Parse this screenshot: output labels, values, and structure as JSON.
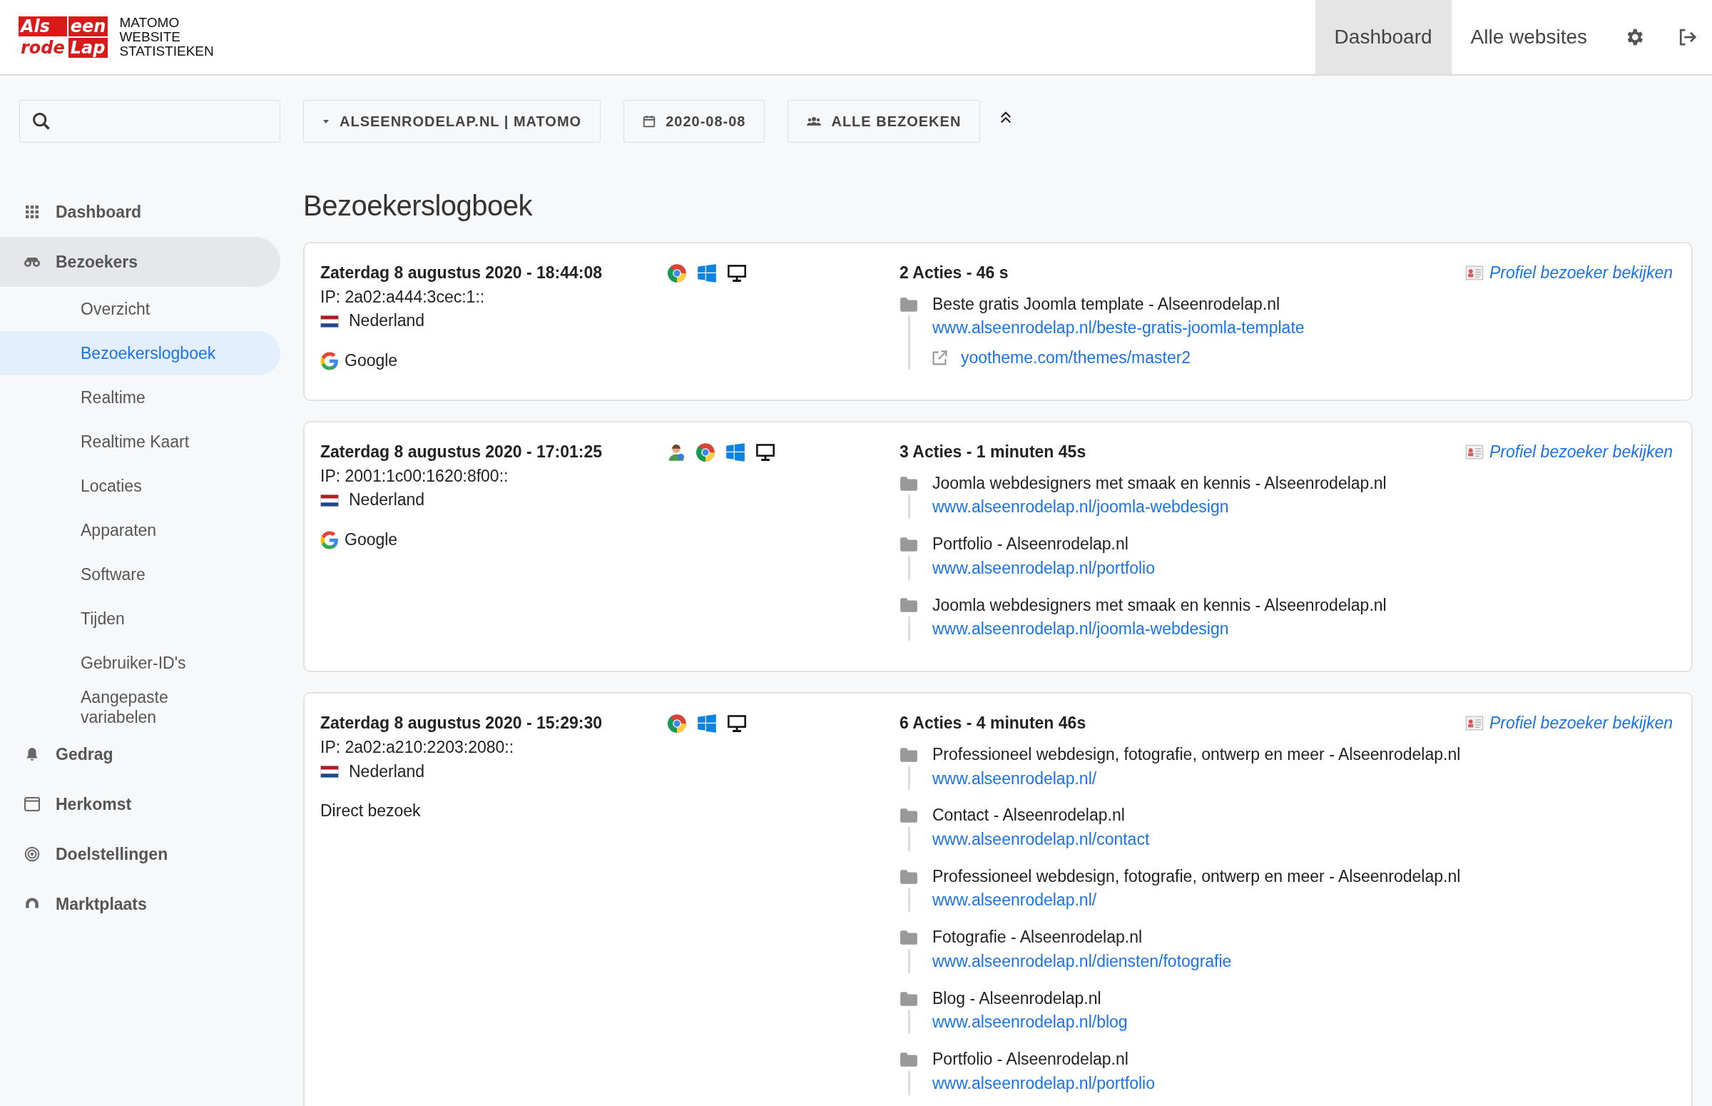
{
  "logo": {
    "words": [
      "Als",
      "een",
      "rode",
      "Lap"
    ],
    "caption": [
      "MATOMO",
      "WEBSITE",
      "STATISTIEKEN"
    ]
  },
  "header_nav": [
    {
      "label": "Dashboard",
      "selected": true
    },
    {
      "label": "Alle websites",
      "selected": false
    }
  ],
  "toolbar": {
    "site": "ALSEENRODELAP.NL | MATOMO",
    "date": "2020-08-08",
    "segment": "ALLE BEZOEKEN"
  },
  "sidebar": {
    "items": [
      {
        "label": "Dashboard",
        "expanded": false
      },
      {
        "label": "Bezoekers",
        "expanded": true,
        "children": [
          {
            "label": "Overzicht",
            "selected": false
          },
          {
            "label": "Bezoekerslogboek",
            "selected": true
          },
          {
            "label": "Realtime",
            "selected": false
          },
          {
            "label": "Realtime Kaart",
            "selected": false
          },
          {
            "label": "Locaties",
            "selected": false
          },
          {
            "label": "Apparaten",
            "selected": false
          },
          {
            "label": "Software",
            "selected": false
          },
          {
            "label": "Tijden",
            "selected": false
          },
          {
            "label": "Gebruiker-ID's",
            "selected": false
          },
          {
            "label": "Aangepaste variabelen",
            "selected": false
          }
        ]
      },
      {
        "label": "Gedrag",
        "expanded": false
      },
      {
        "label": "Herkomst",
        "expanded": false
      },
      {
        "label": "Doelstellingen",
        "expanded": false
      },
      {
        "label": "Marktplaats",
        "expanded": false
      }
    ]
  },
  "page_title": "Bezoekerslogboek",
  "visits": [
    {
      "datetime": "Zaterdag 8 augustus 2020 - 18:44:08",
      "ip": "IP: 2a02:a444:3cec:1::",
      "country": "Nederland",
      "returning": false,
      "referrer": {
        "kind": "search",
        "label": "Google"
      },
      "summary": "2 Acties - 46 s",
      "profile_link": "Profiel bezoeker bekijken",
      "actions": [
        {
          "title": "Beste gratis Joomla template - Alseenrodelap.nl",
          "url": "www.alseenrodelap.nl/beste-gratis-joomla-template",
          "outlink": "yootheme.com/themes/master2"
        }
      ]
    },
    {
      "datetime": "Zaterdag 8 augustus 2020 - 17:01:25",
      "ip": "IP: 2001:1c00:1620:8f00::",
      "country": "Nederland",
      "returning": true,
      "referrer": {
        "kind": "search",
        "label": "Google"
      },
      "summary": "3 Acties - 1 minuten 45s",
      "profile_link": "Profiel bezoeker bekijken",
      "actions": [
        {
          "title": "Joomla webdesigners met smaak en kennis - Alseenrodelap.nl",
          "url": "www.alseenrodelap.nl/joomla-webdesign"
        },
        {
          "title": "Portfolio - Alseenrodelap.nl",
          "url": "www.alseenrodelap.nl/portfolio"
        },
        {
          "title": "Joomla webdesigners met smaak en kennis - Alseenrodelap.nl",
          "url": "www.alseenrodelap.nl/joomla-webdesign"
        }
      ]
    },
    {
      "datetime": "Zaterdag 8 augustus 2020 - 15:29:30",
      "ip": "IP: 2a02:a210:2203:2080::",
      "country": "Nederland",
      "returning": false,
      "referrer": {
        "kind": "direct",
        "label": "Direct bezoek"
      },
      "summary": "6 Acties - 4 minuten 46s",
      "profile_link": "Profiel bezoeker bekijken",
      "actions": [
        {
          "title": "Professioneel webdesign, fotografie, ontwerp en meer - Alseenrodelap.nl",
          "url": "www.alseenrodelap.nl/"
        },
        {
          "title": "Contact - Alseenrodelap.nl",
          "url": "www.alseenrodelap.nl/contact"
        },
        {
          "title": "Professioneel webdesign, fotografie, ontwerp en meer - Alseenrodelap.nl",
          "url": "www.alseenrodelap.nl/"
        },
        {
          "title": "Fotografie - Alseenrodelap.nl",
          "url": "www.alseenrodelap.nl/diensten/fotografie"
        },
        {
          "title": "Blog - Alseenrodelap.nl",
          "url": "www.alseenrodelap.nl/blog"
        },
        {
          "title": "Portfolio - Alseenrodelap.nl",
          "url": "www.alseenrodelap.nl/portfolio"
        }
      ]
    }
  ]
}
